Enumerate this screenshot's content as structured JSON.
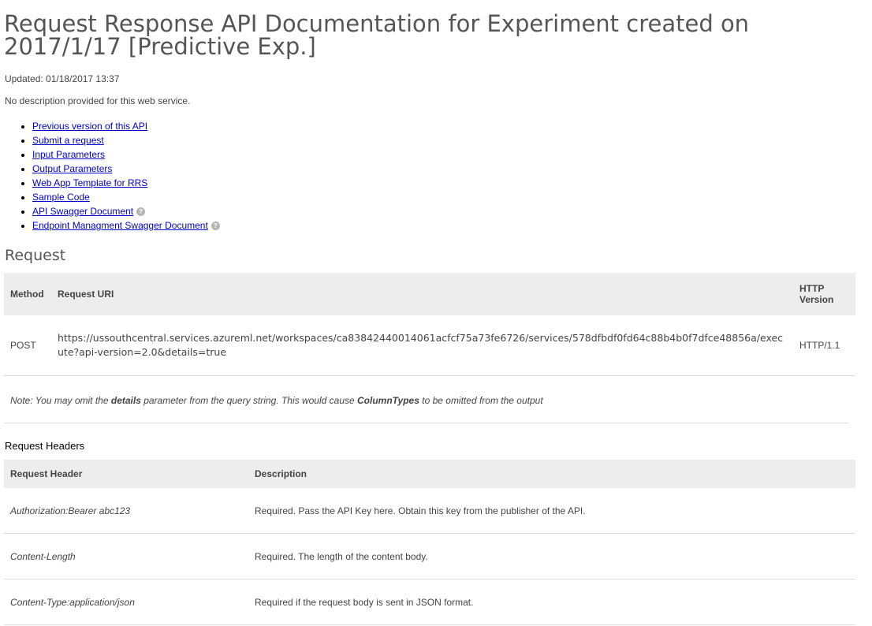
{
  "title": "Request Response API Documentation for Experiment created on 2017/1/17 [Predictive Exp.]",
  "updated": "Updated: 01/18/2017 13:37",
  "description": "No description provided for this web service.",
  "links": [
    {
      "label": "Previous version of this API",
      "help": false
    },
    {
      "label": "Submit a request",
      "help": false
    },
    {
      "label": "Input Parameters",
      "help": false
    },
    {
      "label": "Output Parameters",
      "help": false
    },
    {
      "label": "Web App Template for RRS",
      "help": false
    },
    {
      "label": "Sample Code",
      "help": false
    },
    {
      "label": "API Swagger Document",
      "help": true
    },
    {
      "label": "Endpoint Managment Swagger Document",
      "help": true
    }
  ],
  "help_glyph": "?",
  "request": {
    "heading": "Request",
    "columns": {
      "method": "Method",
      "uri": "Request URI",
      "version": "HTTP Version"
    },
    "row": {
      "method": "POST",
      "uri": "https://ussouthcentral.services.azureml.net/workspaces/ca83842440014061acfcf75a73fe6726/services/578dfbdf0fd64c88b4b0f7dfce48856a/execute?api-version=2.0&details=true",
      "version": "HTTP/1.1"
    },
    "note": {
      "part1": "Note: You may omit the ",
      "bold1": "details",
      "part2": " parameter from the query string. This would cause ",
      "bold2": "ColumnTypes",
      "part3": " to be omitted from the output"
    }
  },
  "headers": {
    "heading": "Request Headers",
    "columns": {
      "name": "Request Header",
      "description": "Description"
    },
    "rows": [
      {
        "name": "Authorization:Bearer abc123",
        "description": "Required. Pass the API Key here. Obtain this key from the publisher of the API."
      },
      {
        "name": "Content-Length",
        "description": "Required. The length of the content body."
      },
      {
        "name": "Content-Type:application/json",
        "description": "Required if the request body is sent in JSON format."
      }
    ]
  }
}
